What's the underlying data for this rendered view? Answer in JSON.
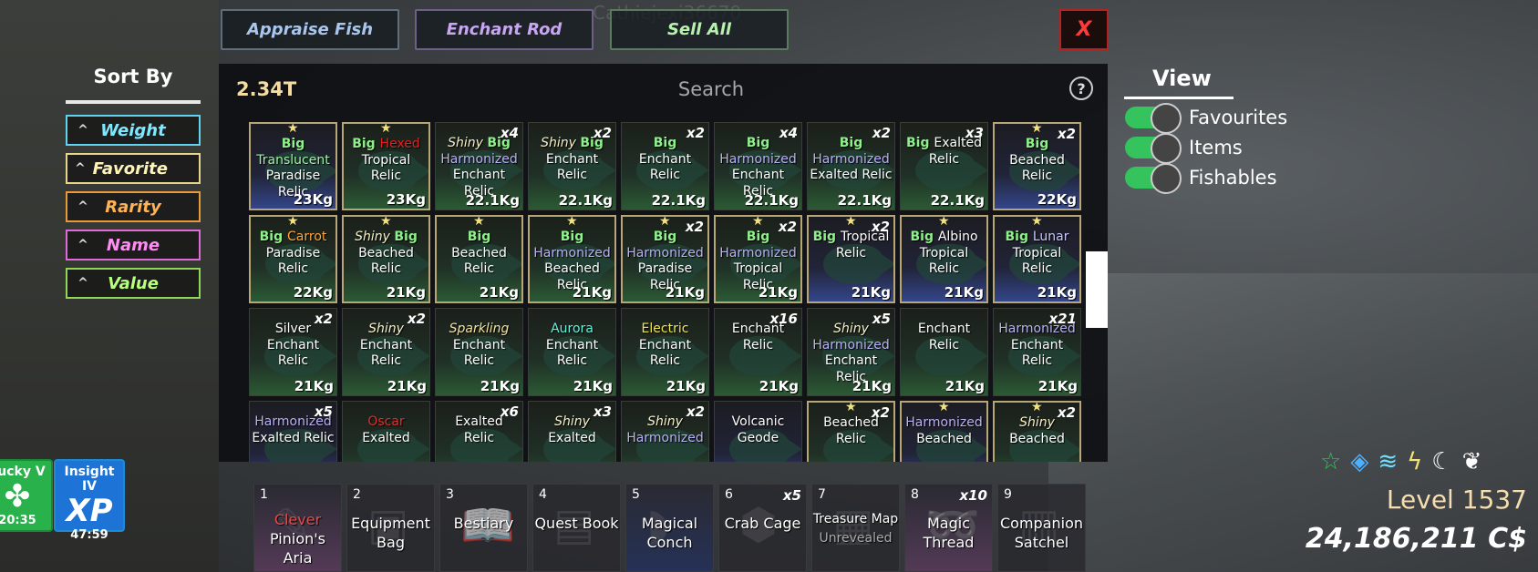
{
  "username": "Cathiejexi36670",
  "buttons": {
    "appraise": "Appraise Fish",
    "enchant": "Enchant Rod",
    "sell": "Sell All",
    "close": "X"
  },
  "sort": {
    "title": "Sort By",
    "options": [
      {
        "label": "Weight",
        "color": "#7fe8ff",
        "border": "#5fd3f0"
      },
      {
        "label": "Favorite",
        "color": "#fff4b8",
        "border": "#e8d58a"
      },
      {
        "label": "Rarity",
        "color": "#ffb357",
        "border": "#e89a3a"
      },
      {
        "label": "Name",
        "color": "#ff8cf2",
        "border": "#e06bd8"
      },
      {
        "label": "Value",
        "color": "#b7ff7c",
        "border": "#8fd65a"
      }
    ]
  },
  "money": "2.34T",
  "search": {
    "placeholder": "Search"
  },
  "help": "?",
  "items": [
    {
      "lines": [
        [
          "Big",
          "c-big"
        ],
        [
          "Translucent",
          "c-trans"
        ],
        [
          "Paradise",
          ""
        ],
        [
          "Relic",
          ""
        ]
      ],
      "weight": "23Kg",
      "qty": "",
      "fav": true,
      "blue": true
    },
    {
      "lines": [
        [
          "Big ",
          "c-big"
        ],
        [
          "Hexed",
          "c-hex"
        ],
        [
          "Tropical Relic",
          ""
        ]
      ],
      "weight": "23Kg",
      "qty": "",
      "fav": true,
      "blue": false
    },
    {
      "lines": [
        [
          "Shiny ",
          "c-shiny"
        ],
        [
          "Big",
          "c-big"
        ],
        [
          "Harmonized",
          "c-harm"
        ],
        [
          "Enchant Relic",
          ""
        ]
      ],
      "weight": "22.1Kg",
      "qty": "x4",
      "fav": false,
      "blue": false
    },
    {
      "lines": [
        [
          "Shiny ",
          "c-shiny"
        ],
        [
          "Big",
          "c-big"
        ],
        [
          "Enchant",
          ""
        ],
        [
          "Relic",
          ""
        ]
      ],
      "weight": "22.1Kg",
      "qty": "x2",
      "fav": false,
      "blue": false
    },
    {
      "lines": [
        [
          "Big",
          "c-big"
        ],
        [
          "Enchant",
          ""
        ],
        [
          "Relic",
          ""
        ]
      ],
      "weight": "22.1Kg",
      "qty": "x2",
      "fav": false,
      "blue": false
    },
    {
      "lines": [
        [
          "Big",
          "c-big"
        ],
        [
          "Harmonized",
          "c-harm"
        ],
        [
          "Enchant Relic",
          ""
        ]
      ],
      "weight": "22.1Kg",
      "qty": "x4",
      "fav": false,
      "blue": false
    },
    {
      "lines": [
        [
          "Big",
          "c-big"
        ],
        [
          "Harmonized",
          "c-harm"
        ],
        [
          "Exalted Relic",
          ""
        ]
      ],
      "weight": "22.1Kg",
      "qty": "x2",
      "fav": false,
      "blue": false
    },
    {
      "lines": [
        [
          "Big ",
          "c-big"
        ],
        [
          "Exalted",
          ""
        ],
        [
          "Relic",
          ""
        ]
      ],
      "weight": "22.1Kg",
      "qty": "x3",
      "fav": false,
      "blue": false
    },
    {
      "lines": [
        [
          "Big",
          "c-big"
        ],
        [
          "Beached",
          ""
        ],
        [
          "Relic",
          ""
        ]
      ],
      "weight": "22Kg",
      "qty": "x2",
      "fav": true,
      "blue": true
    },
    {
      "lines": [
        [
          "Big ",
          "c-big"
        ],
        [
          "Carrot",
          "c-carrot"
        ],
        [
          "Paradise",
          ""
        ],
        [
          "Relic",
          ""
        ]
      ],
      "weight": "22Kg",
      "qty": "",
      "fav": true,
      "blue": false
    },
    {
      "lines": [
        [
          "Shiny ",
          "c-shiny"
        ],
        [
          "Big",
          "c-big"
        ],
        [
          "Beached",
          ""
        ],
        [
          "Relic",
          ""
        ]
      ],
      "weight": "21Kg",
      "qty": "",
      "fav": true,
      "blue": false
    },
    {
      "lines": [
        [
          "Big",
          "c-big"
        ],
        [
          "Beached",
          ""
        ],
        [
          "Relic",
          ""
        ]
      ],
      "weight": "21Kg",
      "qty": "",
      "fav": true,
      "blue": false
    },
    {
      "lines": [
        [
          "Big",
          "c-big"
        ],
        [
          "Harmonized",
          "c-harm"
        ],
        [
          "Beached",
          ""
        ],
        [
          "Relic",
          ""
        ]
      ],
      "weight": "21Kg",
      "qty": "",
      "fav": true,
      "blue": false
    },
    {
      "lines": [
        [
          "Big",
          "c-big"
        ],
        [
          "Harmonized",
          "c-harm"
        ],
        [
          "Paradise",
          ""
        ],
        [
          "Relic",
          ""
        ]
      ],
      "weight": "21Kg",
      "qty": "x2",
      "fav": true,
      "blue": false
    },
    {
      "lines": [
        [
          "Big",
          "c-big"
        ],
        [
          "Harmonized",
          "c-harm"
        ],
        [
          "Tropical Relic",
          ""
        ]
      ],
      "weight": "21Kg",
      "qty": "x2",
      "fav": true,
      "blue": false
    },
    {
      "lines": [
        [
          "Big ",
          "c-big"
        ],
        [
          "Tropical",
          ""
        ],
        [
          "Relic",
          ""
        ]
      ],
      "weight": "21Kg",
      "qty": "x2",
      "fav": true,
      "blue": true
    },
    {
      "lines": [
        [
          "Big ",
          "c-big"
        ],
        [
          "Albino",
          "c-albino"
        ],
        [
          "Tropical Relic",
          ""
        ]
      ],
      "weight": "21Kg",
      "qty": "",
      "fav": true,
      "blue": true
    },
    {
      "lines": [
        [
          "Big ",
          "c-big"
        ],
        [
          "Lunar",
          "c-lunar"
        ],
        [
          "Tropical Relic",
          ""
        ]
      ],
      "weight": "21Kg",
      "qty": "",
      "fav": true,
      "blue": true
    },
    {
      "lines": [
        [
          "Silver",
          "c-silver"
        ],
        [
          "Enchant",
          ""
        ],
        [
          "Relic",
          ""
        ]
      ],
      "weight": "21Kg",
      "qty": "x2",
      "fav": false,
      "blue": false
    },
    {
      "lines": [
        [
          "Shiny",
          "c-shiny"
        ],
        [
          "Enchant",
          ""
        ],
        [
          "Relic",
          ""
        ]
      ],
      "weight": "21Kg",
      "qty": "x2",
      "fav": false,
      "blue": false
    },
    {
      "lines": [
        [
          "Sparkling",
          "c-spark"
        ],
        [
          "Enchant Relic",
          ""
        ]
      ],
      "weight": "21Kg",
      "qty": "",
      "fav": false,
      "blue": false
    },
    {
      "lines": [
        [
          "Aurora",
          "c-aurora"
        ],
        [
          "Enchant",
          ""
        ],
        [
          "Relic",
          ""
        ]
      ],
      "weight": "21Kg",
      "qty": "",
      "fav": false,
      "blue": false
    },
    {
      "lines": [
        [
          "Electric",
          "c-electric"
        ],
        [
          "Enchant Relic",
          ""
        ]
      ],
      "weight": "21Kg",
      "qty": "",
      "fav": false,
      "blue": false
    },
    {
      "lines": [
        [
          "Enchant",
          ""
        ],
        [
          "Relic",
          ""
        ]
      ],
      "weight": "21Kg",
      "qty": "x16",
      "fav": false,
      "blue": false
    },
    {
      "lines": [
        [
          "Shiny",
          "c-shiny"
        ],
        [
          "Harmonized",
          "c-harm"
        ],
        [
          "Enchant Relic",
          ""
        ]
      ],
      "weight": "21Kg",
      "qty": "x5",
      "fav": false,
      "blue": false
    },
    {
      "lines": [
        [
          "Enchant",
          ""
        ],
        [
          "Relic",
          ""
        ]
      ],
      "weight": "21Kg",
      "qty": "",
      "fav": false,
      "blue": false
    },
    {
      "lines": [
        [
          "Harmonized",
          "c-harm"
        ],
        [
          "Enchant Relic",
          ""
        ]
      ],
      "weight": "21Kg",
      "qty": "x21",
      "fav": false,
      "blue": false
    },
    {
      "lines": [
        [
          "Harmonized",
          "c-harm"
        ],
        [
          "Exalted Relic",
          ""
        ]
      ],
      "weight": "",
      "qty": "x5",
      "fav": false,
      "blue": true
    },
    {
      "lines": [
        [
          "Oscar",
          "c-oscar"
        ],
        [
          "Exalted",
          ""
        ]
      ],
      "weight": "",
      "qty": "",
      "fav": false,
      "blue": false
    },
    {
      "lines": [
        [
          "Exalted",
          ""
        ],
        [
          "Relic",
          ""
        ]
      ],
      "weight": "",
      "qty": "x6",
      "fav": false,
      "blue": false
    },
    {
      "lines": [
        [
          "Shiny",
          "c-shiny"
        ],
        [
          "Exalted",
          ""
        ]
      ],
      "weight": "",
      "qty": "x3",
      "fav": false,
      "blue": false
    },
    {
      "lines": [
        [
          "Shiny",
          "c-shiny"
        ],
        [
          "Harmonized",
          "c-harm"
        ]
      ],
      "weight": "",
      "qty": "x2",
      "fav": false,
      "blue": false
    },
    {
      "lines": [
        [
          "Volcanic",
          ""
        ],
        [
          "Geode",
          ""
        ]
      ],
      "weight": "",
      "qty": "",
      "fav": false,
      "blue": true
    },
    {
      "lines": [
        [
          "Beached",
          ""
        ],
        [
          "Relic",
          ""
        ]
      ],
      "weight": "",
      "qty": "x2",
      "fav": true,
      "blue": false
    },
    {
      "lines": [
        [
          "Harmonized",
          "c-harm"
        ],
        [
          "Beached",
          ""
        ]
      ],
      "weight": "",
      "qty": "",
      "fav": true,
      "blue": true
    },
    {
      "lines": [
        [
          "Shiny",
          "c-shiny"
        ],
        [
          "Beached",
          ""
        ]
      ],
      "weight": "",
      "qty": "x2",
      "fav": true,
      "blue": false
    }
  ],
  "view": {
    "title": "View",
    "toggles": [
      "Favourites",
      "Items",
      "Fishables"
    ]
  },
  "buffs": [
    {
      "title": "Lucky V",
      "icon": "clover-icon",
      "glyph": "✤",
      "time": "20:35"
    },
    {
      "title": "Insight IV",
      "icon": "xp-icon",
      "glyph": "XP",
      "time": "47:59"
    }
  ],
  "status_icons": [
    "☆",
    "◈",
    "≋",
    "ϟ",
    "☾",
    "❦"
  ],
  "level": "Level 1537",
  "currency": "24,186,211 C$",
  "hotbar": [
    {
      "num": "1",
      "top": "Clever",
      "label": "Pinion's Aria",
      "qty": "",
      "style": "pink",
      "glyph": "✎"
    },
    {
      "num": "2",
      "top": "",
      "label": "Equipment Bag",
      "qty": "",
      "style": "",
      "glyph": "▣"
    },
    {
      "num": "3",
      "top": "",
      "label": "Bestiary",
      "qty": "",
      "style": "",
      "glyph": "📖"
    },
    {
      "num": "4",
      "top": "",
      "label": "Quest Book",
      "qty": "",
      "style": "",
      "glyph": "▤"
    },
    {
      "num": "5",
      "top": "",
      "label": "Magical Conch",
      "qty": "",
      "style": "blue",
      "glyph": "◗"
    },
    {
      "num": "6",
      "top": "",
      "label": "Crab Cage",
      "qty": "x5",
      "style": "",
      "glyph": "⬢"
    },
    {
      "num": "7",
      "top": "",
      "label": "Treasure Map",
      "sub": "Unrevealed",
      "qty": "",
      "style": "",
      "glyph": "▦"
    },
    {
      "num": "8",
      "top": "",
      "label": "Magic Thread",
      "qty": "x10",
      "style": "pink",
      "glyph": "➿"
    },
    {
      "num": "9",
      "top": "",
      "label": "Companion Satchel",
      "qty": "",
      "style": "",
      "glyph": "▥"
    }
  ]
}
